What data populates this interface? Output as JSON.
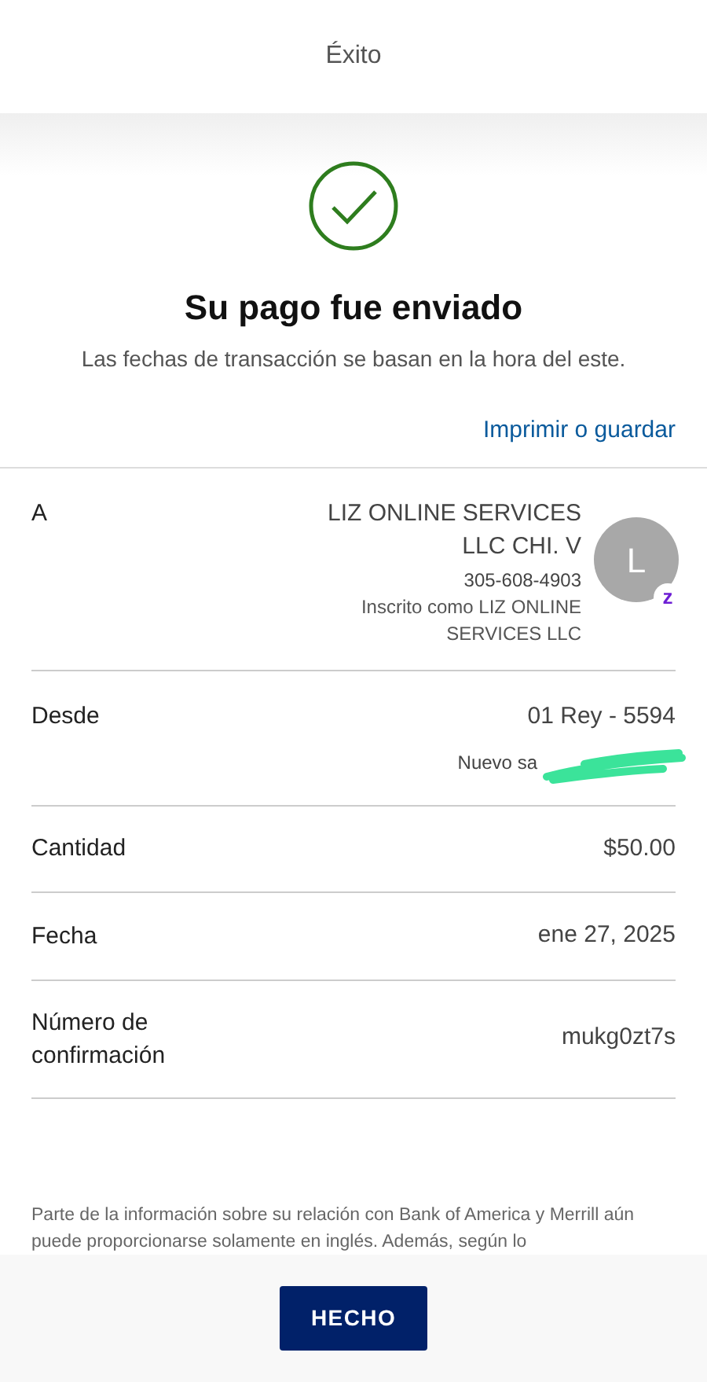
{
  "header": {
    "title": "Éxito"
  },
  "confirmation": {
    "title": "Su pago fue enviado",
    "subtitle": "Las fechas de transacción se basan en la hora del este.",
    "print_link": "Imprimir o guardar"
  },
  "recipient": {
    "label": "A",
    "name_lines": [
      "LIZ ONLINE SERVICES",
      "LLC CHI. V"
    ],
    "phone": "305-608-4903",
    "enrolled_lines": [
      "Inscrito como LIZ ONLINE",
      "SERVICES LLC"
    ],
    "avatar_initial": "L",
    "badge": "z"
  },
  "source": {
    "label": "Desde",
    "account": "01 Rey - 5594",
    "balance_label": "Nuevo sa"
  },
  "details": [
    {
      "label": "Cantidad",
      "value": "$50.00"
    },
    {
      "label": "Fecha",
      "value": "ene 27, 2025"
    },
    {
      "label": "Número de confirmación",
      "value": "mukg0zt7s"
    }
  ],
  "disclaimer": "Parte de la información sobre su relación con Bank of America y Merrill aún puede proporcionarse solamente en inglés. Además, según lo",
  "footer": {
    "button": "HECHO"
  }
}
